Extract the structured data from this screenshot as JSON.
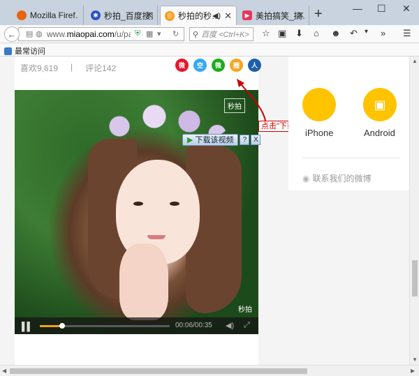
{
  "tabs": [
    {
      "label": "Mozilla Firef…",
      "icon": "firefox-icon",
      "color": "#e8650f"
    },
    {
      "label": "秒拍_百度搜索",
      "icon": "baidu-paw-icon",
      "color": "#2b53c9"
    },
    {
      "label": "秒拍的秒…",
      "icon": "miaopai-icon",
      "color": "#ff9a1a",
      "active": true
    },
    {
      "label": "美拍搞笑_搞…",
      "icon": "meipai-icon",
      "color": "#e8365a"
    }
  ],
  "new_tab_label": "+",
  "window_controls": {
    "minimize": "—",
    "maximize": "☐",
    "close": "✕"
  },
  "nav": {
    "url_prefix": "www.",
    "url_host": "miaopai.com",
    "url_rest": "/u/pai",
    "search_placeholder": "百度 <Ctrl+K>"
  },
  "bookmarks": {
    "label": "最常访问"
  },
  "stats": {
    "likes": "喜欢9,619",
    "separator": "|",
    "comments": "评论142"
  },
  "share_icons": [
    {
      "name": "weibo-share-icon",
      "color": "#e6162d",
      "glyph": "微"
    },
    {
      "name": "qzone-share-icon",
      "color": "#37a8f3",
      "glyph": "空"
    },
    {
      "name": "wechat-share-icon",
      "color": "#1aad19",
      "glyph": "微"
    },
    {
      "name": "moments-share-icon",
      "color": "#f5a623",
      "glyph": "圈"
    },
    {
      "name": "renren-share-icon",
      "color": "#1e5fa6",
      "glyph": "人"
    }
  ],
  "video": {
    "watermark": "秒拍",
    "watermark_bottom": "秒拍",
    "time": "00:06/00:35",
    "progress": 0.17
  },
  "download": {
    "button_label": "下载该视频",
    "help": "?",
    "close": "X"
  },
  "callout": {
    "text": "点击\"下载该视频\""
  },
  "apps": [
    {
      "label": "iPhone",
      "icon": "apple-icon"
    },
    {
      "label": "Android",
      "icon": "android-icon"
    }
  ],
  "weibo_link": "联系我们的微博",
  "colors": {
    "brand_yellow": "#ffc300",
    "progress": "#f0a31b",
    "callout_red": "#cc0000"
  }
}
